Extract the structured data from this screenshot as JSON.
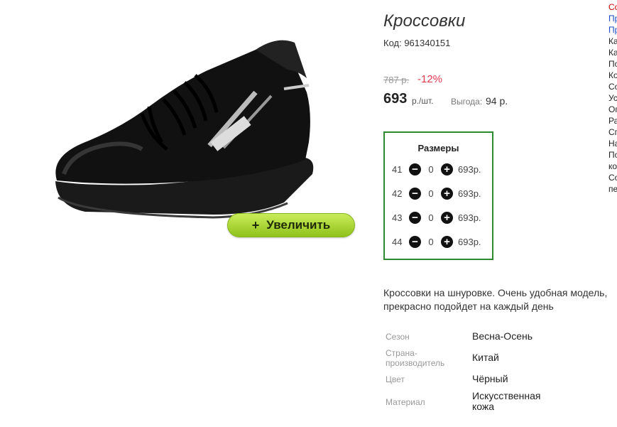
{
  "product": {
    "title": "Кроссовки",
    "code": "Код: 961340151",
    "old_price": "787 р.",
    "discount": "-12%",
    "price": "693",
    "price_unit": "р./шт.",
    "savings_label": "Выгода:",
    "savings_value": "94 р.",
    "zoom_label": "Увеличить",
    "description": "Кроссовки на шнуровке. Очень удобная модель, прекрасно подойдет на каждый день"
  },
  "sizes": {
    "title": "Размеры",
    "rows": [
      {
        "size": "41",
        "qty": "0",
        "price": "693р."
      },
      {
        "size": "42",
        "qty": "0",
        "price": "693р."
      },
      {
        "size": "43",
        "qty": "0",
        "price": "693р."
      },
      {
        "size": "44",
        "qty": "0",
        "price": "693р."
      }
    ]
  },
  "specs": [
    {
      "label": "Сезон",
      "value": "Весна-Осень"
    },
    {
      "label": "Страна-производитель",
      "value": "Китай"
    },
    {
      "label": "Цвет",
      "value": "Чёрный"
    },
    {
      "label": "Материал",
      "value": "Искусственная кожа"
    }
  ],
  "sidebar": {
    "items": [
      "Со",
      "Пр",
      "Пр",
      "Ка",
      "Ка",
      "По",
      "Ко",
      "Со",
      "Ус",
      "Оп",
      "Ра",
      "Сп",
      "На",
      "По",
      "ко",
      "Со",
      "пе"
    ]
  },
  "colors": {
    "accent_green": "#2e8a2e",
    "discount_red": "#e0384c",
    "button_green": "#8fc21a"
  }
}
